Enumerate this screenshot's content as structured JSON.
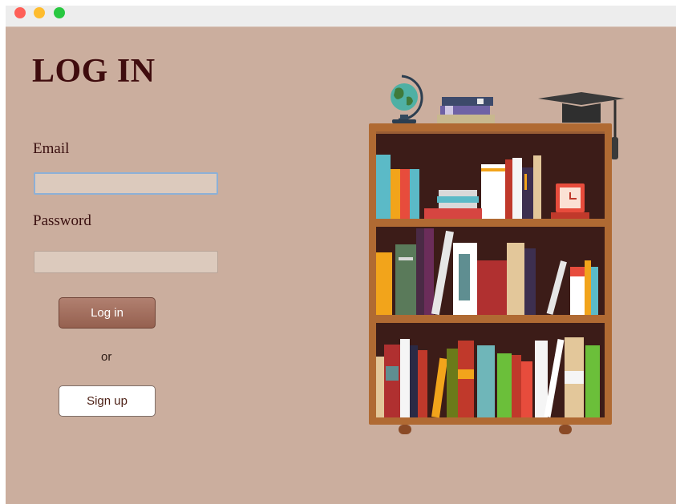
{
  "window": {
    "controls": {
      "close": "close-icon",
      "minimize": "minimize-icon",
      "zoom": "zoom-icon"
    }
  },
  "form": {
    "title": "LOG IN",
    "email_label": "Email",
    "email_value": "",
    "password_label": "Password",
    "password_value": "",
    "login_label": "Log in",
    "or_text": "or",
    "signup_label": "Sign up"
  },
  "illustration": {
    "name": "bookshelf-illustration",
    "items": [
      "globe-icon",
      "stacked-books-icon",
      "graduation-cap-icon",
      "clock-icon"
    ]
  },
  "colors": {
    "background": "#cbae9e",
    "title": "#3f0c0e",
    "login_button": "#a3705f",
    "input_bg": "#dccabd",
    "focus_ring": "#8db0d6"
  }
}
